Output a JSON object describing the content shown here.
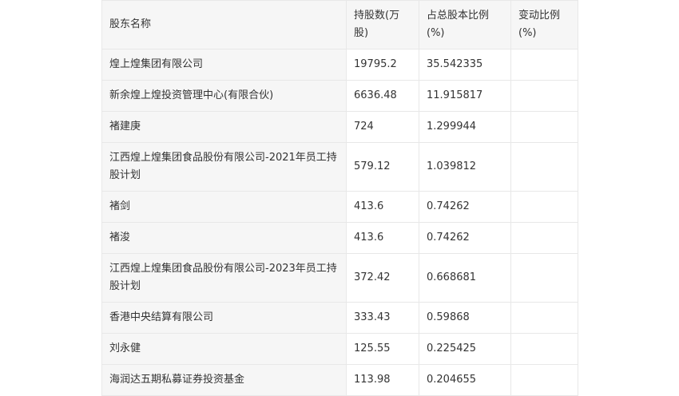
{
  "table": {
    "headers": [
      "股东名称",
      "持股数(万股)",
      "占总股本比例(%)",
      "变动比例(%)"
    ],
    "rows": [
      {
        "name": "煌上煌集团有限公司",
        "shares": "19795.2",
        "ratio": "35.542335",
        "change": ""
      },
      {
        "name": "新余煌上煌投资管理中心(有限合伙)",
        "shares": "6636.48",
        "ratio": "11.915817",
        "change": ""
      },
      {
        "name": "褚建庚",
        "shares": "724",
        "ratio": "1.299944",
        "change": ""
      },
      {
        "name": "江西煌上煌集团食品股份有限公司-2021年员工持股计划",
        "shares": "579.12",
        "ratio": "1.039812",
        "change": ""
      },
      {
        "name": "褚剑",
        "shares": "413.6",
        "ratio": "0.74262",
        "change": ""
      },
      {
        "name": "褚浚",
        "shares": "413.6",
        "ratio": "0.74262",
        "change": ""
      },
      {
        "name": "江西煌上煌集团食品股份有限公司-2023年员工持股计划",
        "shares": "372.42",
        "ratio": "0.668681",
        "change": ""
      },
      {
        "name": "香港中央结算有限公司",
        "shares": "333.43",
        "ratio": "0.59868",
        "change": ""
      },
      {
        "name": "刘永健",
        "shares": "125.55",
        "ratio": "0.225425",
        "change": ""
      },
      {
        "name": "海润达五期私募证券投资基金",
        "shares": "113.98",
        "ratio": "0.204655",
        "change": ""
      }
    ]
  }
}
